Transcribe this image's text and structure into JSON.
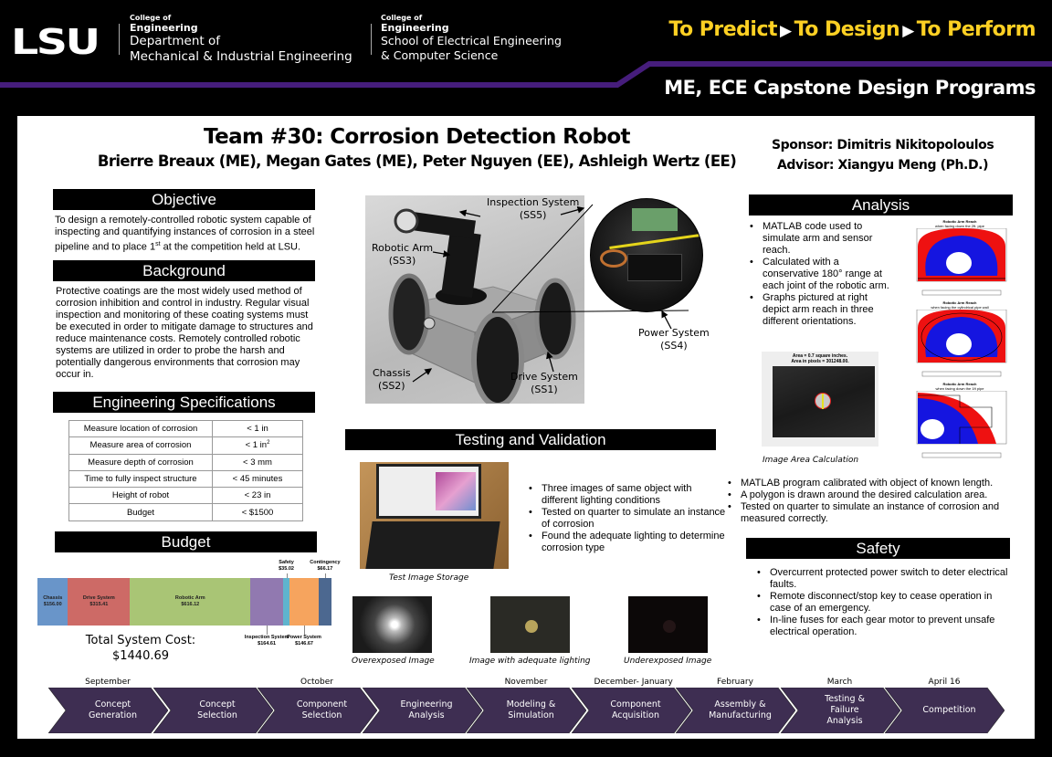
{
  "header": {
    "logo": "LSU",
    "left_block": {
      "college": "College of",
      "engineering": "Engineering",
      "dept_line1": "Department of",
      "dept_line2": "Mechanical & Industrial Engineering"
    },
    "right_block": {
      "college": "College of",
      "engineering": "Engineering",
      "school_line1": "School of Electrical Engineering",
      "school_line2": "& Computer Science"
    },
    "tagline": {
      "part1": "To Predict",
      "part2": "To Design",
      "part3": "To Perform",
      "arrow": "▶"
    },
    "programs": "ME, ECE Capstone Design Programs",
    "colors": {
      "purple": "#461d7c",
      "gold": "#fdd023"
    }
  },
  "title": {
    "main": "Team #30: Corrosion Detection Robot",
    "authors": "Brierre Breaux (ME), Megan Gates (ME), Peter Nguyen (EE), Ashleigh Wertz (EE)",
    "sponsor": "Sponsor: Dimitris Nikitopoloulos",
    "advisor": "Advisor: Xiangyu Meng (Ph.D.)"
  },
  "objective": {
    "heading": "Objective",
    "text_before": "To design a remotely-controlled robotic system capable of inspecting and quantifying instances of corrosion in a steel pipeline and to place 1",
    "sup": "st",
    "text_after": " at the competition held at LSU."
  },
  "background": {
    "heading": "Background",
    "text": "Protective coatings are the most widely used method of corrosion inhibition and control in industry. Regular visual inspection and monitoring of these coating systems must be executed in order to mitigate damage to structures and reduce maintenance costs. Remotely controlled robotic systems are utilized in order to probe the harsh and potentially dangerous environments that corrosion may occur in."
  },
  "specs": {
    "heading": "Engineering Specifications",
    "rows": [
      {
        "measure": "Measure location of corrosion",
        "value": "< 1 in"
      },
      {
        "measure": "Measure area of corrosion",
        "value": "< 1 in",
        "sup": "2"
      },
      {
        "measure": "Measure depth of corrosion",
        "value": "< 3 mm"
      },
      {
        "measure": "Time to fully inspect structure",
        "value": "< 45 minutes"
      },
      {
        "measure": "Height of robot",
        "value": "< 23 in"
      },
      {
        "measure": "Budget",
        "value": "< $1500"
      }
    ]
  },
  "budget": {
    "heading": "Budget",
    "total_label": "Total System Cost:",
    "total_value": "$1440.69",
    "segments": [
      {
        "name": "Chassis",
        "value": 156.0,
        "label": "$156.00",
        "color": "#6995c9",
        "label_pos": "inside"
      },
      {
        "name": "Drive System",
        "value": 315.41,
        "label": "$315.41",
        "color": "#cd6a66",
        "label_pos": "inside"
      },
      {
        "name": "Robotic Arm",
        "value": 616.12,
        "label": "$616.12",
        "color": "#a9c575",
        "label_pos": "inside"
      },
      {
        "name": "Inspection System",
        "value": 164.61,
        "label": "$164.61",
        "color": "#9179b0",
        "label_pos": "below"
      },
      {
        "name": "Safety",
        "value": 35.02,
        "label": "$35.02",
        "color": "#5fb4ce",
        "label_pos": "above"
      },
      {
        "name": "Power System",
        "value": 146.67,
        "label": "$146.67",
        "color": "#f6a45e",
        "label_pos": "below"
      },
      {
        "name": "Contingency",
        "value": 66.17,
        "label": "$66.17",
        "color": "#4c6890",
        "label_pos": "above"
      }
    ]
  },
  "robot_figure": {
    "labels": {
      "inspection": [
        "Inspection System",
        "(SS5)"
      ],
      "arm": [
        "Robotic Arm",
        "(SS3)"
      ],
      "power": [
        "Power System",
        "(SS4)"
      ],
      "chassis": [
        "Chassis",
        "(SS2)"
      ],
      "drive": [
        "Drive System",
        "(SS1)"
      ]
    }
  },
  "testing": {
    "heading": "Testing and Validation",
    "bullets": [
      "Three images of same object with different lighting conditions",
      "Tested on quarter to simulate an instance of corrosion",
      "Found the adequate lighting to determine corrosion type"
    ],
    "laptop_caption": "Test Image Storage",
    "images": [
      {
        "caption": "Overexposed Image"
      },
      {
        "caption": "Image with adequate lighting"
      },
      {
        "caption": "Underexposed Image"
      }
    ]
  },
  "analysis": {
    "heading": "Analysis",
    "bullets": [
      "MATLAB code used to simulate arm and sensor reach.",
      "Calculated with a conservative 180° range at each joint of the robotic arm.",
      "Graphs pictured at right depict arm reach in three different orientations."
    ],
    "plots": [
      {
        "title1": "Robotic Arm Reach",
        "title2": "when facing down the 2ft. pipe"
      },
      {
        "title1": "Robotic Arm Reach",
        "title2": "when facing the cylindrical pipe wall"
      },
      {
        "title1": "Robotic Arm Reach",
        "title2": "when facing down the 1ft pipe"
      }
    ],
    "area_image": {
      "line1": "Area =     0.7 square inches.",
      "line2": "Area in pixels = 301248.00.",
      "caption": "Image Area Calculation"
    },
    "bullets2": [
      "MATLAB  program calibrated  with object of known length.",
      "A polygon is drawn around the desired calculation area.",
      "Tested on quarter to simulate an instance of corrosion and measured correctly."
    ]
  },
  "safety": {
    "heading": "Safety",
    "bullets": [
      "Overcurrent protected power switch to deter electrical faults.",
      "Remote disconnect/stop key to cease operation in case of an emergency.",
      "In-line fuses for each gear motor to prevent unsafe electrical operation."
    ]
  },
  "timeline": {
    "color": "#3e2e52",
    "months": [
      "September",
      "October",
      "November",
      "December- January",
      "February",
      "March",
      "April 16"
    ],
    "steps": [
      "Concept\nGeneration",
      "Concept\nSelection",
      "Component\nSelection",
      "Engineering\nAnalysis",
      "Modeling &\nSimulation",
      "Component\nAcquisition",
      "Assembly &\nManufacturing",
      "Testing &\nFailure\nAnalysis",
      "Competition"
    ]
  }
}
